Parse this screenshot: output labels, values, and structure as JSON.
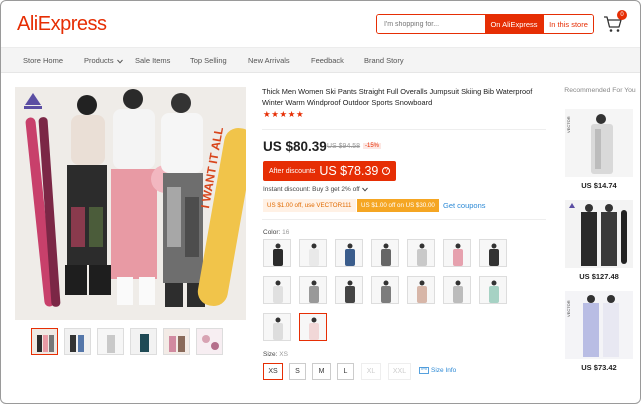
{
  "header": {
    "logo": "AliExpress",
    "search_placeholder": "I'm shopping for...",
    "search_on_aliexpress": "On AliExpress",
    "search_in_store": "In this store",
    "cart_count": "0"
  },
  "nav": {
    "items": [
      "Store Home",
      "Products",
      "Sale Items",
      "Top Selling",
      "New Arrivals",
      "Feedback",
      "Brand Story"
    ]
  },
  "product": {
    "title": "Thick Men Women Ski Pants Straight Full Overalls Jumpsuit Skiing Bib Waterproof Winter Warm Windproof Outdoor Sports Snowboard",
    "rating_stars": 5,
    "price": "US $80.39",
    "original_price": "US $94.58",
    "discount_percent": "-15%",
    "after_discounts_label": "After discounts",
    "after_discounts_price": "US $78.39",
    "instant_discount": "Instant discount: Buy 3 get 2% off",
    "coupons": [
      "US $1.00 off, use VECTOR111",
      "US $1.00 off on US $30.00"
    ],
    "get_coupons": "Get coupons",
    "color_label": "Color:",
    "color_value": "16",
    "size_label": "Size:",
    "size_value": "XS",
    "sizes": [
      "XS",
      "S",
      "M",
      "L",
      "XL",
      "XXL"
    ],
    "size_info": "Size Info",
    "main_image_text": "I WANT IT ALL"
  },
  "recommended": {
    "title": "Recommended For You",
    "items": [
      {
        "price": "US $14.74",
        "watermark": "VECTOR"
      },
      {
        "price": "US $127.48",
        "watermark": "VECTOR"
      },
      {
        "price": "US $73.42",
        "watermark": "VECTOR"
      }
    ]
  },
  "colors": {
    "accent": "#e62e04",
    "link": "#2d8ad6",
    "coupon_orange": "#f5a623"
  }
}
